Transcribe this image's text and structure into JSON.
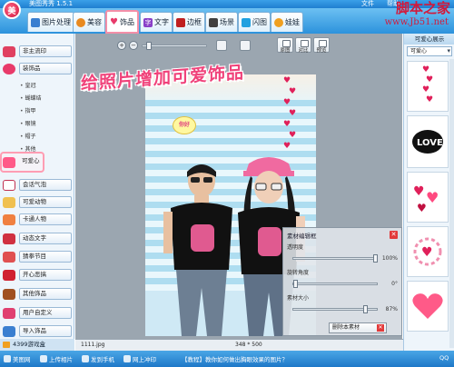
{
  "app": {
    "title": "美图秀秀 1.5.1",
    "logo_text": "美"
  },
  "menu": [
    "文件",
    "帮助"
  ],
  "tabs": [
    {
      "label": "图片处理",
      "icon": "photo-icon",
      "color": "#3a7fd0"
    },
    {
      "label": "美容",
      "icon": "face-icon",
      "color": "#e88a20"
    },
    {
      "label": "饰品",
      "icon": "heart-icon",
      "color": "#e83a6a",
      "active": true
    },
    {
      "label": "文字",
      "icon": "text-icon",
      "color": "#8a40c8"
    },
    {
      "label": "边框",
      "icon": "frame-icon",
      "color": "#c02020"
    },
    {
      "label": "场景",
      "icon": "scene-icon",
      "color": "#404040"
    },
    {
      "label": "闪图",
      "icon": "flash-icon",
      "color": "#20a0e0"
    },
    {
      "label": "娃娃",
      "icon": "doll-icon",
      "color": "#f0a020"
    }
  ],
  "sidebar": {
    "items": [
      {
        "label": "非主流印",
        "icon": "stamp-icon"
      },
      {
        "label": "装饰品",
        "icon": "bow-icon"
      },
      {
        "label": "会话气泡",
        "icon": "bubble-icon"
      },
      {
        "label": "可爱动物",
        "icon": "animal-icon"
      },
      {
        "label": "卡通人物",
        "icon": "cartoon-icon"
      },
      {
        "label": "动态文字",
        "icon": "anim-text-icon"
      },
      {
        "label": "猜拳节目",
        "icon": "rps-icon"
      },
      {
        "label": "开心恶搞",
        "icon": "fun-icon"
      },
      {
        "label": "其他饰品",
        "icon": "misc-icon"
      },
      {
        "label": "用户自定义",
        "icon": "user-icon"
      }
    ],
    "subitems": [
      "皇冠",
      "蝴蝶结",
      "指甲",
      "眼镜",
      "帽子",
      "其他"
    ],
    "selected": "可爱心",
    "import_label": "导入饰品"
  },
  "toolbar": {
    "zoom_in": "+",
    "zoom_out": "−",
    "buttons": [
      "原图",
      "对比",
      "预览"
    ]
  },
  "canvas": {
    "headline": "给照片增加可爱饰品",
    "speech_text": "你好",
    "hearts": [
      "♥",
      "♥",
      "♥",
      "♥",
      "♥",
      "♥",
      "♥"
    ]
  },
  "props": {
    "title": "素材编辑框",
    "fields": [
      {
        "label": "透明度",
        "value": "100%",
        "fraction": 1.0
      },
      {
        "label": "旋转角度",
        "value": "0°",
        "fraction": 0.0
      },
      {
        "label": "素材大小",
        "value": "87%",
        "fraction": 0.87
      }
    ],
    "delete_label": "删除本素材"
  },
  "rightpanel": {
    "title": "可爱心展示",
    "select_value": "可爱心",
    "thumbs": [
      "heart-column-icon",
      "love-badge-icon",
      "heart-cluster-icon",
      "heart-ring-icon",
      "heart-banner-icon"
    ]
  },
  "statusbar": {
    "filename": "1111.jpg",
    "dims": "348 * 500",
    "left_label": "4399游戏盒"
  },
  "bottombar": {
    "items": [
      "美图网",
      "上传相片",
      "发到手机",
      "网上冲印"
    ],
    "notice": "【教程】教你如何做出胸眼效果的图片？",
    "right_label": "QQ"
  },
  "watermark": {
    "line1": "脚本之家",
    "line2": "www.Jb51.net"
  },
  "colors": {
    "accent": "#2c92dc",
    "pink": "#f0427a",
    "highlight": "#ff9db3"
  }
}
